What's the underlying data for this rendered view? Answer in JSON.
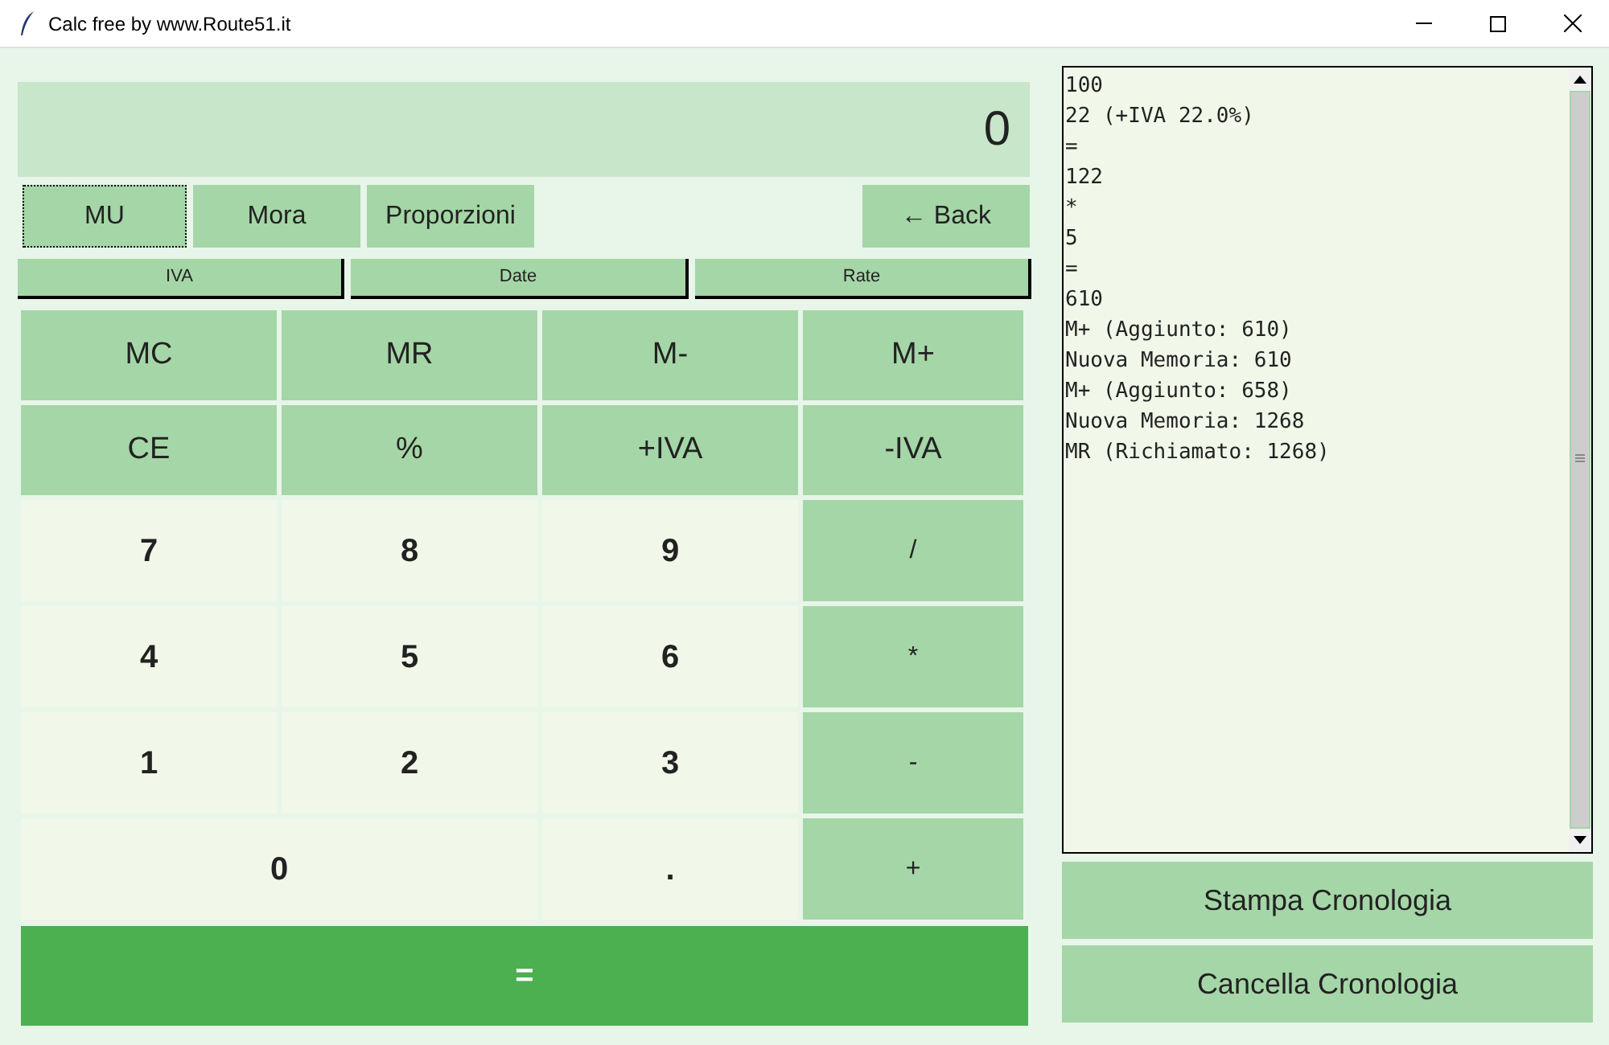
{
  "window": {
    "title": "Calc free by www.Route51.it"
  },
  "display": {
    "value": "0"
  },
  "mode_buttons": [
    {
      "label": "MU",
      "focused": true
    },
    {
      "label": "Mora",
      "focused": false
    },
    {
      "label": "Proporzioni",
      "focused": false
    }
  ],
  "back_button": {
    "label": "← Back"
  },
  "tool_buttons": [
    "IVA",
    "Date",
    "Rate"
  ],
  "keys": [
    {
      "label": "MC",
      "kind": "func"
    },
    {
      "label": "MR",
      "kind": "func"
    },
    {
      "label": "M-",
      "kind": "func"
    },
    {
      "label": "M+",
      "kind": "func"
    },
    {
      "label": "CE",
      "kind": "func"
    },
    {
      "label": "%",
      "kind": "func"
    },
    {
      "label": "+IVA",
      "kind": "func"
    },
    {
      "label": "-IVA",
      "kind": "func"
    },
    {
      "label": "7",
      "kind": "digit"
    },
    {
      "label": "8",
      "kind": "digit"
    },
    {
      "label": "9",
      "kind": "digit"
    },
    {
      "label": "/",
      "kind": "op"
    },
    {
      "label": "4",
      "kind": "digit"
    },
    {
      "label": "5",
      "kind": "digit"
    },
    {
      "label": "6",
      "kind": "digit"
    },
    {
      "label": "*",
      "kind": "op"
    },
    {
      "label": "1",
      "kind": "digit"
    },
    {
      "label": "2",
      "kind": "digit"
    },
    {
      "label": "3",
      "kind": "digit"
    },
    {
      "label": "-",
      "kind": "op"
    },
    {
      "label": "0",
      "kind": "wide"
    },
    {
      "label": ".",
      "kind": "digit"
    },
    {
      "label": "+",
      "kind": "op"
    }
  ],
  "equals_button": {
    "label": "="
  },
  "history": [
    "100",
    "22 (+IVA 22.0%)",
    "=",
    "122",
    "*",
    "5",
    "=",
    "610",
    "M+ (Aggiunto: 610)",
    "Nuova Memoria: 610",
    "M+ (Aggiunto: 658)",
    "Nuova Memoria: 1268",
    "MR (Richiamato: 1268)"
  ],
  "history_buttons": [
    "Stampa Cronologia",
    "Cancella Cronologia"
  ]
}
